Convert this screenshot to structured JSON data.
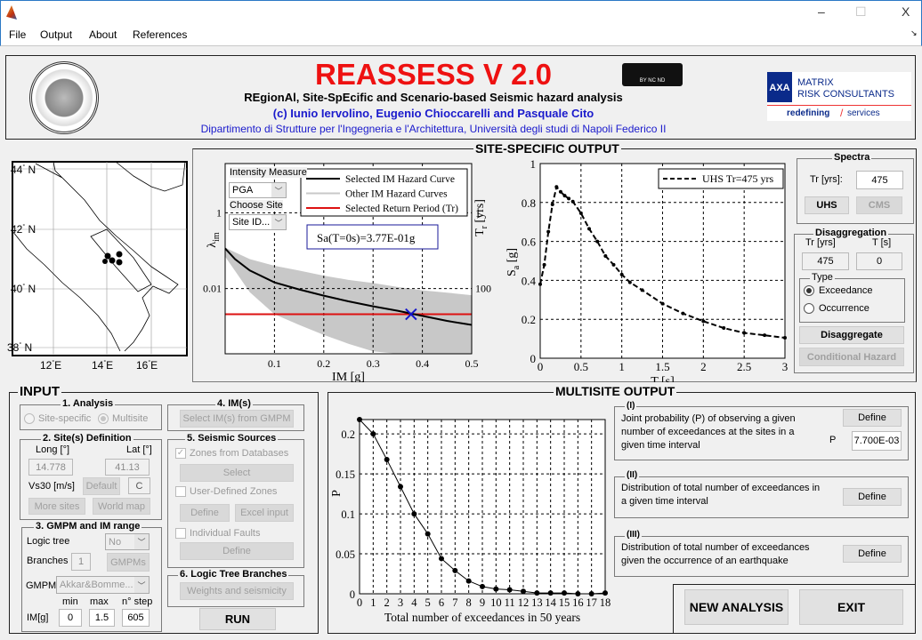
{
  "window": {
    "minimize": "–",
    "maximize": "☐",
    "close": "X",
    "menu_arrow": "↘"
  },
  "menu": [
    "File",
    "Output",
    "About",
    "References"
  ],
  "header": {
    "title": "REASSESS V 2.0",
    "subtitle": "REgionAl, Site-SpEcific and Scenario-based Seismic hazard analysis",
    "authors": "(c) Iunio Iervolino, Eugenio Chioccarelli and Pasquale Cito",
    "department": "Dipartimento di Strutture per l'Ingegneria e l'Architettura, Università degli studi di Napoli Federico II",
    "cc_badge": "BY NC ND",
    "sponsor_logo": {
      "line1": "MATRIX",
      "line2": "RISK CONSULTANTS",
      "tagline_a": "redefining",
      "tagline_b": "services",
      "brand": "AXA"
    },
    "title_color": "#ee1111",
    "blue_text_color": "#1a1acc"
  },
  "map": {
    "lat_labels": [
      "44",
      "42",
      "40",
      "38"
    ],
    "lon_labels": [
      "12",
      "14",
      "16"
    ],
    "deg_n": "N",
    "deg_e": "E"
  },
  "site_specific": {
    "title": "SITE-SPECIFIC OUTPUT",
    "intensity_measure_label": "Intensity Measure",
    "intensity_measure_value": "PGA",
    "choose_site_label": "Choose Site",
    "choose_site_value": "Site ID...",
    "annotation": "Sa(T=0s)=3.77E-01g",
    "spectra": {
      "title": "Spectra",
      "tr_label": "Tr [yrs]:",
      "tr_value": "475",
      "uhs": "UHS",
      "cms": "CMS"
    },
    "disaggregation": {
      "title": "Disaggregation",
      "tr_label": "Tr [yrs]",
      "t_label": "T [s]",
      "tr_value": "475",
      "t_value": "0",
      "type_title": "Type",
      "exceedance": "Exceedance",
      "occurrence": "Occurrence",
      "selected": "Exceedance",
      "disaggregate": "Disaggregate",
      "conditional_hazard": "Conditional Hazard"
    }
  },
  "input": {
    "title": "INPUT",
    "analysis": {
      "title": "1. Analysis",
      "site_specific": "Site-specific",
      "multisite": "Multisite",
      "selected": "Multisite"
    },
    "sites": {
      "title": "2. Site(s) Definition",
      "long_label": "Long [°]",
      "lat_label": "Lat [°]",
      "long_value": "14.778",
      "lat_value": "41.13",
      "vs30_label": "Vs30 [m/s]",
      "default": "Default",
      "vs30_value": "C",
      "more_sites": "More sites",
      "world_map": "World map"
    },
    "gmpm": {
      "title": "3. GMPM and IM range",
      "logic_tree_label": "Logic tree",
      "logic_tree_value": "No",
      "branches_label": "Branches",
      "branches_value": "1",
      "gmpms": "GMPMs",
      "gmpm_label": "GMPM",
      "gmpm_value": "Akkar&Bomme...",
      "min_label": "min",
      "max_label": "max",
      "step_label": "n° step",
      "im_label": "IM[g]",
      "min_value": "0",
      "max_value": "1.5",
      "step_value": "605"
    },
    "ims": {
      "title": "4. IM(s)",
      "select": "Select IM(s) from GMPM"
    },
    "sources": {
      "title": "5. Seismic Sources",
      "zones_db": "Zones from Databases",
      "zones_db_checked": true,
      "select": "Select",
      "user_zones": "User-Defined Zones",
      "define": "Define",
      "excel": "Excel input",
      "faults": "Individual Faults",
      "define2": "Define"
    },
    "logic_tree": {
      "title": "6. Logic Tree Branches",
      "weights": "Weights and seismicity"
    },
    "run": "RUN"
  },
  "multisite": {
    "title": "MULTISITE OUTPUT",
    "boxes": [
      {
        "title": "(I)",
        "text": "Joint probability (P) of observing a given number of exceedances at the sites in a given time interval",
        "button": "Define",
        "p_label": "P",
        "p_value": "7.700E-03"
      },
      {
        "title": "(II)",
        "text": "Distribution of total number of exceedances in a given time interval",
        "button": "Define"
      },
      {
        "title": "(III)",
        "text": "Distribution of total number of exceedances given the occurrence of an earthquake",
        "button": "Define"
      }
    ],
    "new_analysis": "NEW ANALYSIS",
    "exit": "EXIT"
  },
  "chart_data": [
    {
      "type": "line",
      "id": "hazard",
      "xlabel": "IM [g]",
      "ylabel": "λ",
      "ylabel_sub": "im",
      "y2label": "T",
      "y2label_sub": "r",
      "y2label_unit": " [yrs]",
      "xlim": [
        0,
        0.5
      ],
      "ylim": [
        0.00019,
        20
      ],
      "yscale": "log",
      "grid": true,
      "xticks": [
        "0.1",
        "0.2",
        "0.3",
        "0.4",
        "0.5"
      ],
      "yticks": [
        {
          "v": 1,
          "label": "1"
        },
        {
          "v": 0.01,
          "label": "0.01"
        }
      ],
      "y2ticks": [
        {
          "v": 1,
          "label": "1"
        },
        {
          "v": 0.01,
          "label": "100"
        }
      ],
      "legend": [
        "Selected IM Hazard Curve",
        "Other IM Hazard Curves",
        "Selected Return Period (Tr)"
      ],
      "legend_position": "top-right",
      "selected_curve": {
        "x": [
          0,
          0.02,
          0.05,
          0.1,
          0.15,
          0.2,
          0.25,
          0.3,
          0.35,
          0.4,
          0.45,
          0.5
        ],
        "y": [
          0.115,
          0.06,
          0.03,
          0.0146,
          0.0095,
          0.0065,
          0.0046,
          0.0034,
          0.0026,
          0.0019,
          0.0014,
          0.0011
        ]
      },
      "other_curves_envelope": {
        "x": [
          0,
          0.05,
          0.1,
          0.15,
          0.2,
          0.25,
          0.3,
          0.35,
          0.4,
          0.45,
          0.5
        ],
        "upper": [
          0.12,
          0.06,
          0.04,
          0.03,
          0.022,
          0.017,
          0.014,
          0.011,
          0.009,
          0.0078,
          0.0067
        ],
        "lower": [
          0.07,
          0.008,
          0.0021,
          0.0011,
          0.0006,
          0.00035,
          0.00022,
          0.00019,
          0.00019,
          0.00019,
          0.00019
        ]
      },
      "return_period_rate": 0.0021,
      "selected_point": {
        "x": 0.377,
        "y": 0.0021
      },
      "colors": {
        "selected": "#000000",
        "other": "#c8c8c8",
        "return_period": "#dd1111",
        "marker": "#1515cc"
      }
    },
    {
      "type": "line",
      "id": "uhs",
      "xlabel": "T [s]",
      "ylabel": "S",
      "ylabel_sub": "a",
      "ylabel_unit": " [g]",
      "xlim": [
        0,
        3
      ],
      "ylim": [
        0,
        1
      ],
      "grid": true,
      "xticks": [
        "0",
        "0.5",
        "1",
        "1.5",
        "2",
        "2.5",
        "3"
      ],
      "yticks": [
        "0",
        "0.2",
        "0.4",
        "0.6",
        "0.8",
        "1"
      ],
      "legend": [
        "UHS Tr=475 yrs"
      ],
      "legend_position": "top-right",
      "x": [
        0,
        0.05,
        0.1,
        0.15,
        0.2,
        0.25,
        0.3,
        0.35,
        0.4,
        0.5,
        0.6,
        0.7,
        0.8,
        0.9,
        1.0,
        1.1,
        1.25,
        1.5,
        1.75,
        2.0,
        2.25,
        2.5,
        2.75,
        3.0
      ],
      "y": [
        0.38,
        0.48,
        0.65,
        0.79,
        0.88,
        0.855,
        0.835,
        0.82,
        0.805,
        0.745,
        0.665,
        0.6,
        0.525,
        0.48,
        0.43,
        0.39,
        0.35,
        0.28,
        0.23,
        0.19,
        0.155,
        0.13,
        0.118,
        0.105
      ]
    },
    {
      "type": "line",
      "id": "multisite",
      "xlabel": "Total number of exceedances in 50 years",
      "ylabel": "P",
      "xlim": [
        0,
        18
      ],
      "ylim": [
        0,
        0.218
      ],
      "grid": true,
      "xticks": [
        "0",
        "1",
        "2",
        "3",
        "4",
        "5",
        "6",
        "7",
        "8",
        "9",
        "10",
        "11",
        "12",
        "13",
        "14",
        "15",
        "16",
        "17",
        "18"
      ],
      "yticks": [
        "0",
        "0.05",
        "0.1",
        "0.15",
        "0.2"
      ],
      "x": [
        0,
        1,
        2,
        3,
        4,
        5,
        6,
        7,
        8,
        9,
        10,
        11,
        12,
        13,
        14,
        15,
        16,
        17,
        18
      ],
      "y": [
        0.218,
        0.2,
        0.168,
        0.134,
        0.1,
        0.075,
        0.044,
        0.029,
        0.016,
        0.009,
        0.006,
        0.005,
        0.003,
        0.001,
        0.001,
        0.001,
        0,
        0,
        0.001
      ]
    }
  ]
}
